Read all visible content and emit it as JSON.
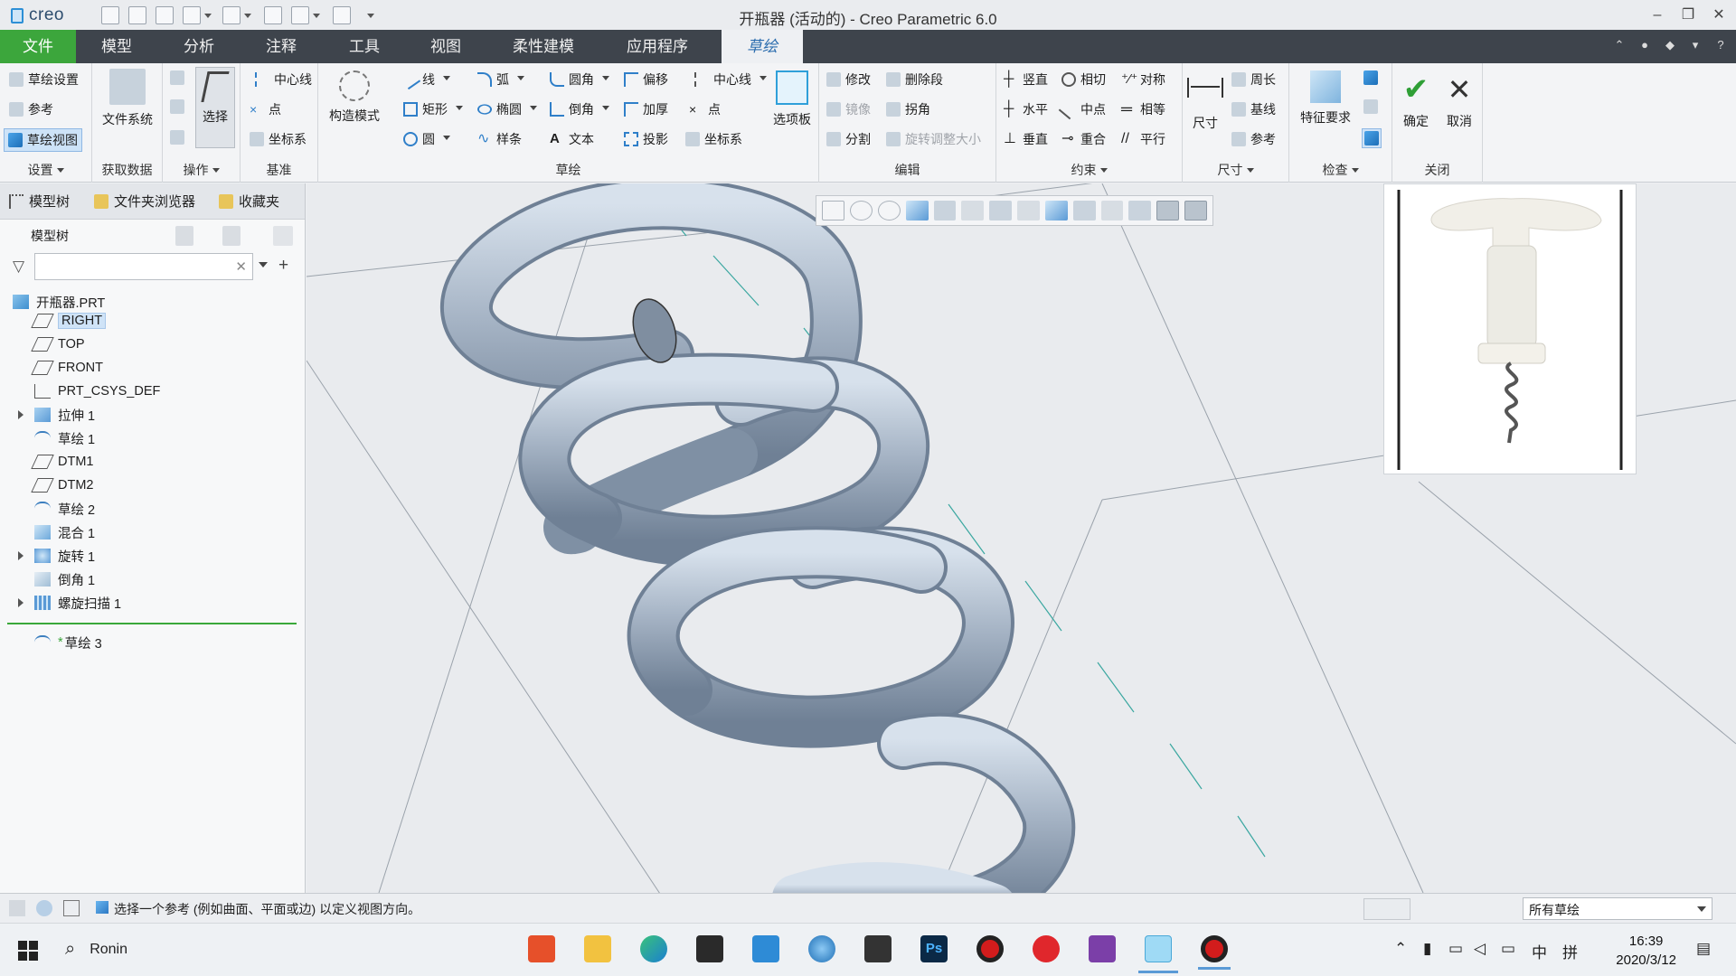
{
  "window": {
    "title": "开瓶器 (活动的) - Creo Parametric 6.0",
    "logo_text": "creo"
  },
  "tabs": [
    "文件",
    "模型",
    "分析",
    "注释",
    "工具",
    "视图",
    "柔性建模",
    "应用程序",
    "草绘"
  ],
  "ribbon": {
    "setup": {
      "items": [
        "草绘设置",
        "参考",
        "草绘视图"
      ],
      "label": "设置"
    },
    "get_data": {
      "button": "文件系统",
      "label": "获取数据"
    },
    "operations": {
      "button": "选择",
      "label": "操作"
    },
    "datum": {
      "items": [
        "中心线",
        "点",
        "坐标系"
      ],
      "label": "基准"
    },
    "sketch": {
      "construction_mode": "构造模式",
      "col1": [
        "线",
        "矩形",
        "圆"
      ],
      "col2": [
        "弧",
        "椭圆",
        "样条"
      ],
      "col3": [
        "圆角",
        "倒角",
        "文本"
      ],
      "col4": [
        "偏移",
        "加厚",
        "投影"
      ],
      "col5": [
        "中心线",
        "点",
        "坐标系"
      ],
      "palette": "选项板",
      "label": "草绘"
    },
    "editing": {
      "items": [
        "修改",
        "删除段",
        "镜像",
        "拐角",
        "分割",
        "旋转调整大小"
      ],
      "label": "编辑"
    },
    "constrain": {
      "items": [
        "竖直",
        "相切",
        "对称",
        "水平",
        "中点",
        "相等",
        "垂直",
        "重合",
        "平行"
      ],
      "label": "约束"
    },
    "dimension": {
      "button": "尺寸",
      "items": [
        "周长",
        "基线",
        "参考"
      ],
      "label": "尺寸"
    },
    "inspect": {
      "button": "特征要求",
      "label": "检查"
    },
    "close": {
      "ok": "确定",
      "cancel": "取消",
      "label": "关闭"
    }
  },
  "left_panel": {
    "tabs": [
      "模型树",
      "文件夹浏览器",
      "收藏夹"
    ],
    "header": "模型树",
    "search_placeholder": "",
    "tree": [
      {
        "label": "开瓶器.PRT",
        "icon": "part-icon"
      },
      {
        "label": "RIGHT",
        "icon": "datum-plane-icon",
        "selected": true
      },
      {
        "label": "TOP",
        "icon": "datum-plane-icon"
      },
      {
        "label": "FRONT",
        "icon": "datum-plane-icon"
      },
      {
        "label": "PRT_CSYS_DEF",
        "icon": "csys-icon"
      },
      {
        "label": "拉伸 1",
        "icon": "extrude-icon",
        "expandable": true
      },
      {
        "label": "草绘 1",
        "icon": "sketch-icon"
      },
      {
        "label": "DTM1",
        "icon": "datum-plane-icon"
      },
      {
        "label": "DTM2",
        "icon": "datum-plane-icon"
      },
      {
        "label": "草绘 2",
        "icon": "sketch-icon"
      },
      {
        "label": "混合 1",
        "icon": "blend-icon"
      },
      {
        "label": "旋转 1",
        "icon": "revolve-icon",
        "expandable": true
      },
      {
        "label": "倒角 1",
        "icon": "chamfer-icon"
      },
      {
        "label": "螺旋扫描 1",
        "icon": "helical-sweep-icon",
        "expandable": true
      },
      {
        "label": "草绘 3",
        "icon": "sketch-icon",
        "marker": "*"
      }
    ]
  },
  "status": {
    "message": "选择一个参考 (例如曲面、平面或边) 以定义视图方向。",
    "filter": "所有草绘"
  },
  "taskbar": {
    "search_text": "Ronin",
    "time": "16:39",
    "date": "2020/3/12",
    "ime": [
      "中",
      "拼"
    ]
  },
  "colors": {
    "accent": "#3ca63c",
    "tabbar": "#3e444c",
    "helix": "#a7b5c6"
  }
}
